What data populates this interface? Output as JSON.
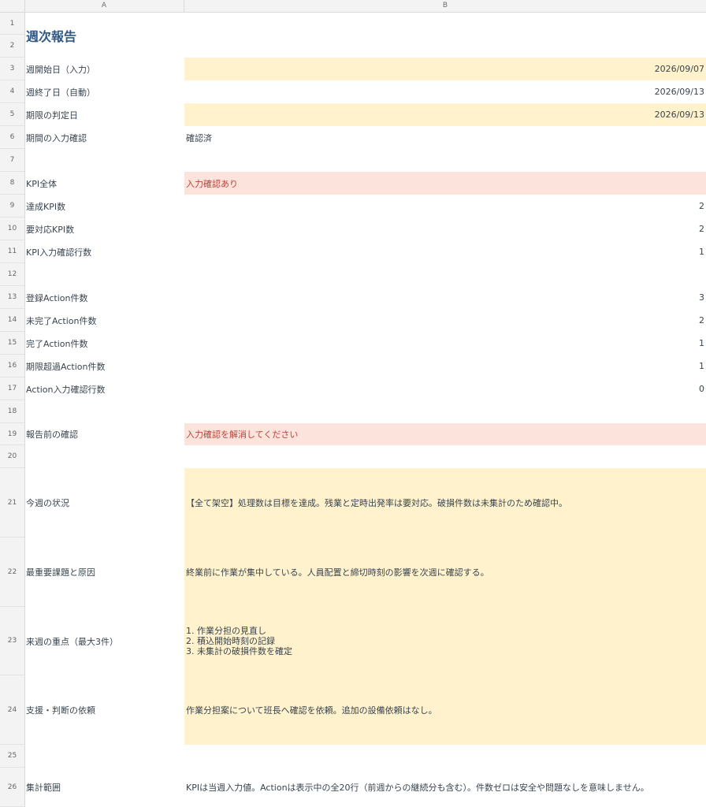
{
  "columns": [
    "A",
    "B"
  ],
  "rows": [
    {
      "n": "1",
      "a": "",
      "b": ""
    },
    {
      "n": "2",
      "a": "",
      "b": ""
    },
    {
      "n": "3",
      "a": "週開始日（入力）",
      "b": "2026/09/07"
    },
    {
      "n": "4",
      "a": "週終了日（自動）",
      "b": "2026/09/13"
    },
    {
      "n": "5",
      "a": "期限の判定日",
      "b": "2026/09/13"
    },
    {
      "n": "6",
      "a": "期間の入力確認",
      "b": "確認済"
    },
    {
      "n": "7",
      "a": "",
      "b": ""
    },
    {
      "n": "8",
      "a": "KPI全体",
      "b": "入力確認あり"
    },
    {
      "n": "9",
      "a": "達成KPI数",
      "b": "2"
    },
    {
      "n": "10",
      "a": "要対応KPI数",
      "b": "2"
    },
    {
      "n": "11",
      "a": "KPI入力確認行数",
      "b": "1"
    },
    {
      "n": "12",
      "a": "",
      "b": ""
    },
    {
      "n": "13",
      "a": "登録Action件数",
      "b": "3"
    },
    {
      "n": "14",
      "a": "未完了Action件数",
      "b": "2"
    },
    {
      "n": "15",
      "a": "完了Action件数",
      "b": "1"
    },
    {
      "n": "16",
      "a": "期限超過Action件数",
      "b": "1"
    },
    {
      "n": "17",
      "a": "Action入力確認行数",
      "b": "0"
    },
    {
      "n": "18",
      "a": "",
      "b": ""
    },
    {
      "n": "19",
      "a": "報告前の確認",
      "b": "入力確認を解消してください"
    },
    {
      "n": "20",
      "a": "",
      "b": ""
    },
    {
      "n": "21",
      "a": "今週の状況",
      "b": "【全て架空】処理数は目標を達成。残業と定時出発率は要対応。破損件数は未集計のため確認中。"
    },
    {
      "n": "22",
      "a": "最重要課題と原因",
      "b": "終業前に作業が集中している。人員配置と締切時刻の影響を次週に確認する。"
    },
    {
      "n": "23",
      "a": "来週の重点（最大3件）",
      "b": "1. 作業分担の見直し\n2. 積込開始時刻の記録\n3. 未集計の破損件数を確定"
    },
    {
      "n": "24",
      "a": "支援・判断の依頼",
      "b": "作業分担案について班長へ確認を依頼。追加の設備依頼はなし。"
    },
    {
      "n": "25",
      "a": "",
      "b": ""
    },
    {
      "n": "26",
      "a": "集計範囲",
      "b": "KPIは当週入力値。Actionは表示中の全20行（前週からの継続分も含む）。件数ゼロは安全や問題なしを意味しません。"
    }
  ],
  "title": "週次報告",
  "colors": {
    "input_fill": "#fff2cc",
    "alert_fill": "#fce4dc",
    "alert_text": "#b8433a",
    "title_text": "#2f5a86"
  }
}
